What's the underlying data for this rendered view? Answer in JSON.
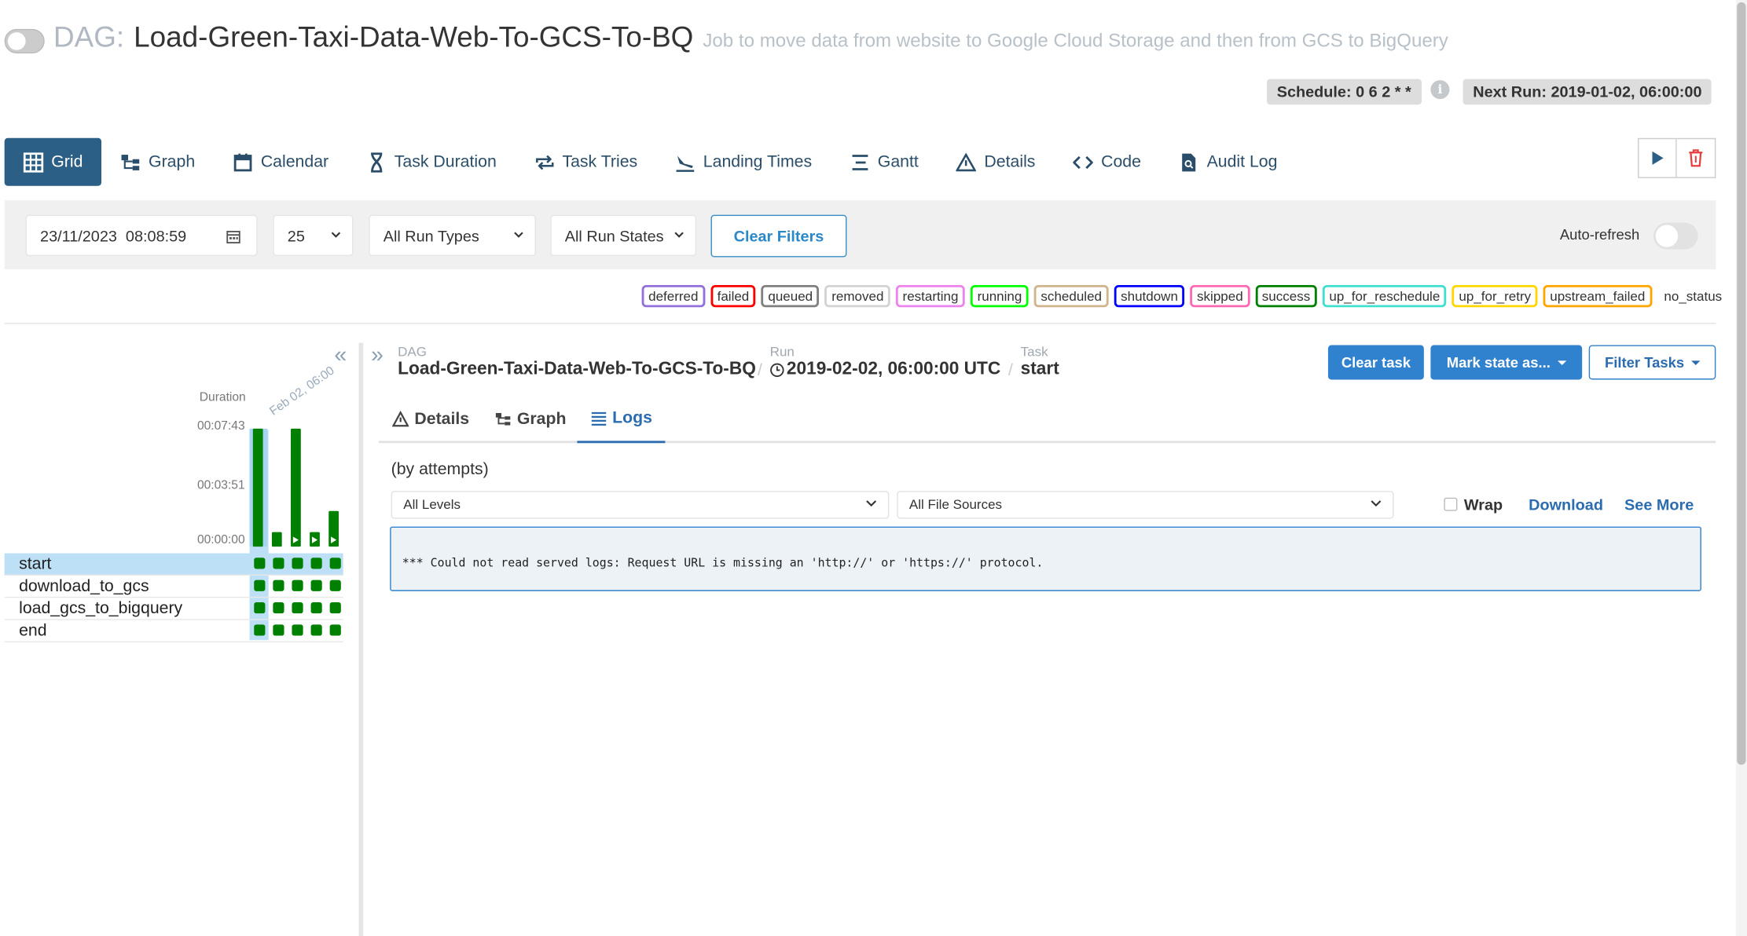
{
  "header": {
    "dag_prefix": "DAG:",
    "dag_name": "Load-Green-Taxi-Data-Web-To-GCS-To-BQ",
    "description": "Job to move data from website to Google Cloud Storage and then from GCS to BigQuery",
    "schedule": "Schedule: 0 6 2 * *",
    "info_glyph": "i",
    "next_run": "Next Run: 2019-01-02, 06:00:00"
  },
  "nav": {
    "tabs": [
      {
        "label": "Grid",
        "icon": "grid-icon",
        "active": true
      },
      {
        "label": "Graph",
        "icon": "graph-icon"
      },
      {
        "label": "Calendar",
        "icon": "calendar-icon"
      },
      {
        "label": "Task Duration",
        "icon": "hourglass-icon"
      },
      {
        "label": "Task Tries",
        "icon": "repeat-icon"
      },
      {
        "label": "Landing Times",
        "icon": "landing-icon"
      },
      {
        "label": "Gantt",
        "icon": "gantt-icon"
      },
      {
        "label": "Details",
        "icon": "warning-triangle-icon"
      },
      {
        "label": "Code",
        "icon": "code-icon"
      },
      {
        "label": "Audit Log",
        "icon": "file-search-icon"
      }
    ]
  },
  "filters": {
    "datetime": "23/11/2023  08:08:59",
    "num_runs": "25",
    "run_types": "All Run Types",
    "run_states": "All Run States",
    "clear_label": "Clear Filters",
    "autorefresh_label": "Auto-refresh"
  },
  "legend": [
    {
      "label": "deferred",
      "color": "#9370db"
    },
    {
      "label": "failed",
      "color": "#ff0000"
    },
    {
      "label": "queued",
      "color": "#808080"
    },
    {
      "label": "removed",
      "color": "#d3d3d3"
    },
    {
      "label": "restarting",
      "color": "#ee82ee"
    },
    {
      "label": "running",
      "color": "#00ff00"
    },
    {
      "label": "scheduled",
      "color": "#d2b48c"
    },
    {
      "label": "shutdown",
      "color": "#0000ff"
    },
    {
      "label": "skipped",
      "color": "#ff69b4"
    },
    {
      "label": "success",
      "color": "#008000"
    },
    {
      "label": "up_for_reschedule",
      "color": "#40e0d0"
    },
    {
      "label": "up_for_retry",
      "color": "#ffd700"
    },
    {
      "label": "upstream_failed",
      "color": "#ffa500"
    },
    {
      "label": "no_status",
      "color": "none"
    }
  ],
  "grid": {
    "collapse_glyph": "«",
    "duration_label": "Duration",
    "date_label": "Feb 02, 06:00",
    "y_ticks": [
      "00:07:43",
      "00:03:51",
      "00:00:00"
    ],
    "run_durations_fraction": [
      1.0,
      0.12,
      1.0,
      0.12,
      0.3
    ],
    "run_selected": [
      true,
      false,
      false,
      false,
      false
    ],
    "tasks": [
      {
        "name": "start",
        "selected": true
      },
      {
        "name": "download_to_gcs",
        "selected": false
      },
      {
        "name": "load_gcs_to_bigquery",
        "selected": false
      },
      {
        "name": "end",
        "selected": false
      }
    ]
  },
  "details": {
    "expand_glyph": "»",
    "crumbs": {
      "dag_key": "DAG",
      "dag_value": "Load-Green-Taxi-Data-Web-To-GCS-To-BQ",
      "run_key": "Run",
      "run_value": "2019-02-02, 06:00:00 UTC",
      "task_key": "Task",
      "task_value": "start",
      "sep": "/"
    },
    "clear_task": "Clear task",
    "mark_state": "Mark state as...",
    "filter_tasks": "Filter Tasks",
    "subtabs": [
      "Details",
      "Graph",
      "Logs"
    ],
    "active_subtab": "Logs",
    "by_attempts": "(by attempts)",
    "levels": "All Levels",
    "file_sources": "All File Sources",
    "wrap_label": "Wrap",
    "download_label": "Download",
    "see_more_label": "See More",
    "log_text": "*** Could not read served logs: Request URL is missing an 'http://' or 'https://' protocol."
  }
}
